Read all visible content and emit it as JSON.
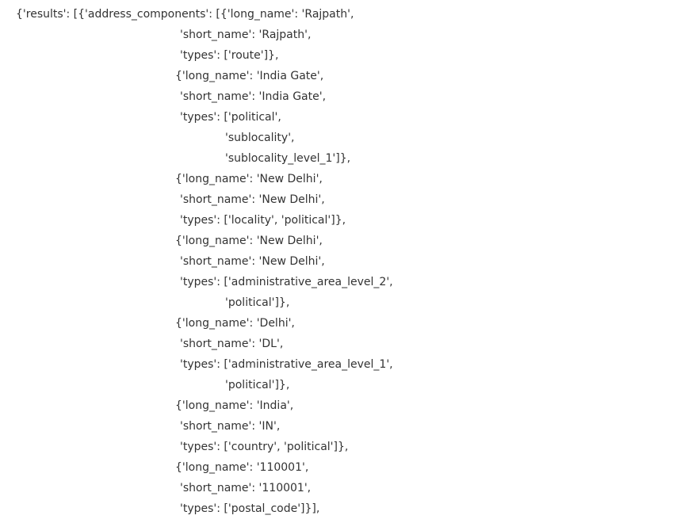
{
  "output": {
    "lines": [
      "{'results': [{'address_components': [{'long_name': 'Rajpath',",
      "'short_name': 'Rajpath',",
      "'types': ['route']},",
      "{'long_name': 'India Gate',",
      "'short_name': 'India Gate',",
      "'types': ['political',",
      "'sublocality',",
      "'sublocality_level_1']},",
      "{'long_name': 'New Delhi',",
      "'short_name': 'New Delhi',",
      "'types': ['locality', 'political']},",
      "{'long_name': 'New Delhi',",
      "'short_name': 'New Delhi',",
      "'types': ['administrative_area_level_2',",
      "'political']},",
      "{'long_name': 'Delhi',",
      "'short_name': 'DL',",
      "'types': ['administrative_area_level_1',",
      "'political']},",
      "{'long_name': 'India',",
      "'short_name': 'IN',",
      "'types': ['country', 'political']},",
      "{'long_name': '110001',",
      "'short_name': '110001',",
      "'types': ['postal_code']}],"
    ]
  }
}
